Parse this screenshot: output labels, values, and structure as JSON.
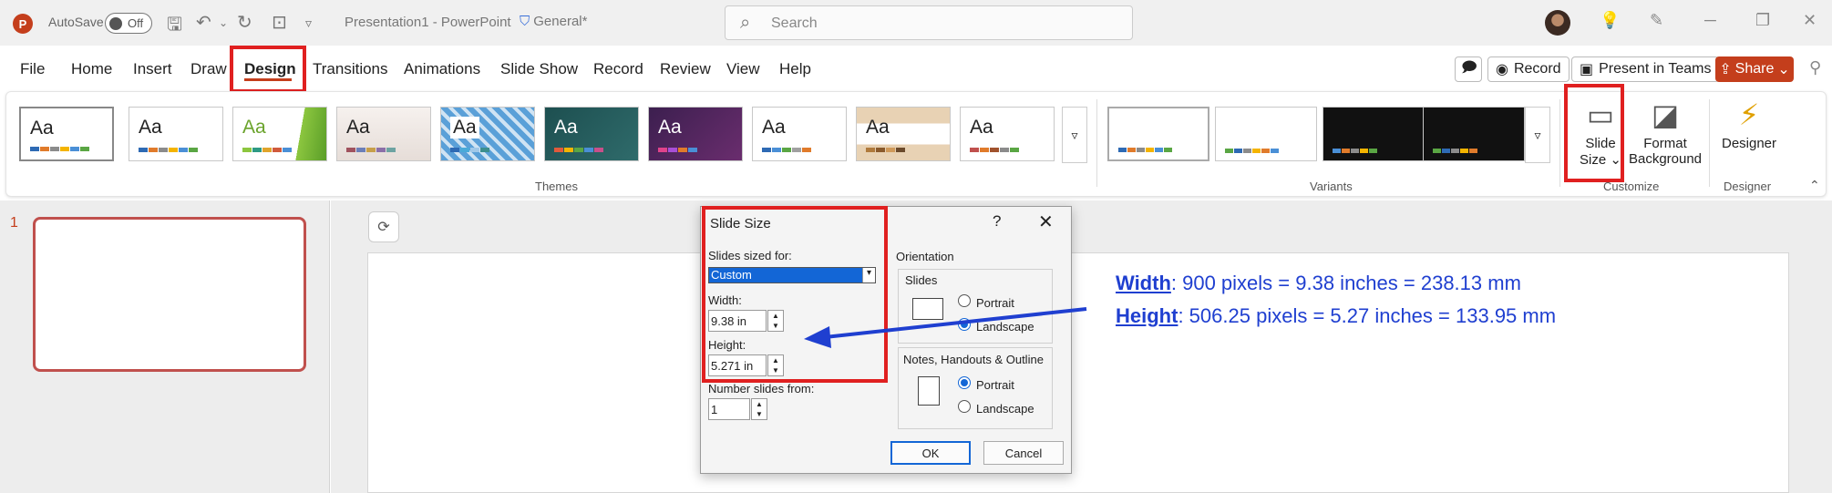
{
  "titlebar": {
    "autosave_label": "AutoSave",
    "autosave_state": "Off",
    "document_title": "Presentation1 - PowerPoint",
    "sensitivity_label": "General*",
    "search_placeholder": "Search"
  },
  "menu": {
    "tabs": [
      "File",
      "Home",
      "Insert",
      "Draw",
      "Design",
      "Transitions",
      "Animations",
      "Slide Show",
      "Record",
      "Review",
      "View",
      "Help"
    ],
    "active_tab": "Design",
    "record_label": "Record",
    "present_teams_label": "Present in Teams",
    "share_label": "Share"
  },
  "ribbon": {
    "themes_group_label": "Themes",
    "theme_sample_text": "Aa",
    "variants_group_label": "Variants",
    "customize_group_label": "Customize",
    "designer_group_label": "Designer",
    "slide_size_label_1": "Slide",
    "slide_size_label_2": "Size",
    "format_background_label_1": "Format",
    "format_background_label_2": "Background",
    "designer_label": "Designer"
  },
  "thumbnails": {
    "slide_number": "1"
  },
  "dialog": {
    "title": "Slide Size",
    "help": "?",
    "close": "✕",
    "slides_sized_for_label": "Slides sized for:",
    "slides_sized_for_value": "Custom",
    "width_label": "Width:",
    "width_value": "9.38 in",
    "height_label": "Height:",
    "height_value": "5.271 in",
    "number_slides_from_label": "Number slides from:",
    "number_slides_from_value": "1",
    "orientation_label": "Orientation",
    "slides_group_label": "Slides",
    "slides_portrait": "Portrait",
    "slides_landscape": "Landscape",
    "notes_group_label": "Notes, Handouts & Outline",
    "notes_portrait": "Portrait",
    "notes_landscape": "Landscape",
    "ok_label": "OK",
    "cancel_label": "Cancel"
  },
  "annotation": {
    "width_key": "Width",
    "width_text": ": 900 pixels = 9.38 inches = 238.13 mm",
    "height_key": "Height",
    "height_text": ": 506.25 pixels = 5.27 inches = 133.95 mm"
  },
  "colors": {
    "accent": "#c43e1c",
    "highlight_box": "#e02020",
    "annotation_text": "#1f3fd0",
    "selection_blue": "#1366d6"
  }
}
